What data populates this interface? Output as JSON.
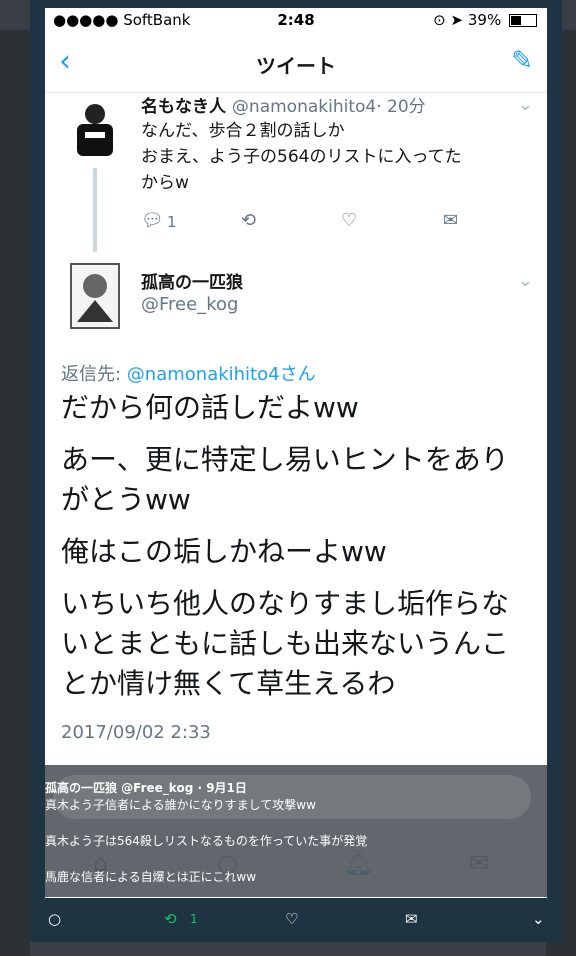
{
  "status": {
    "carrier": "●●●●● SoftBank",
    "time": "2:48",
    "battery": "39%"
  },
  "nav": {
    "back_icon": "chevron-left-icon",
    "title": "ツイート",
    "compose_icon": "compose-tweet-icon"
  },
  "reply_tweet": {
    "name": "名もなき人",
    "handle": "@namonakihito4",
    "age": "· 20分",
    "lines": [
      "なんだ、歩合２割の話しか",
      "おまえ、よう子の564のリストに入ってた",
      "からw"
    ],
    "reply_count": "1"
  },
  "main_tweet": {
    "name": "孤高の一匹狼",
    "handle": "@Free_kog",
    "reply_prefix": "返信先: ",
    "reply_target": "@namonakihito4さん",
    "paragraphs": [
      "だから何の話しだよww",
      "あー、更に特定し易いヒントをありがとうww",
      "俺はこの垢しかねーよww",
      "いちいち他人のなりすまし垢作らないとまともに話しも出来ないうんことか情け無くて草生えるわ"
    ],
    "timestamp": "2017/09/02 2:33"
  },
  "overlay": {
    "header": "孤高の一匹狼 @Free_kog · 9月1日",
    "line1": "真木よう子信者による誰かになりすまして攻撃ww",
    "line2": "真木よう子は564殺しリストなるものを作っていた事が発覚",
    "line3": "馬鹿な信者による自爆とは正にこれww"
  },
  "bottom_bar": {
    "retweet_count": "1"
  },
  "colors": {
    "accent": "#1da1f2",
    "retweet": "#17bf63",
    "frame": "#1f3442"
  }
}
